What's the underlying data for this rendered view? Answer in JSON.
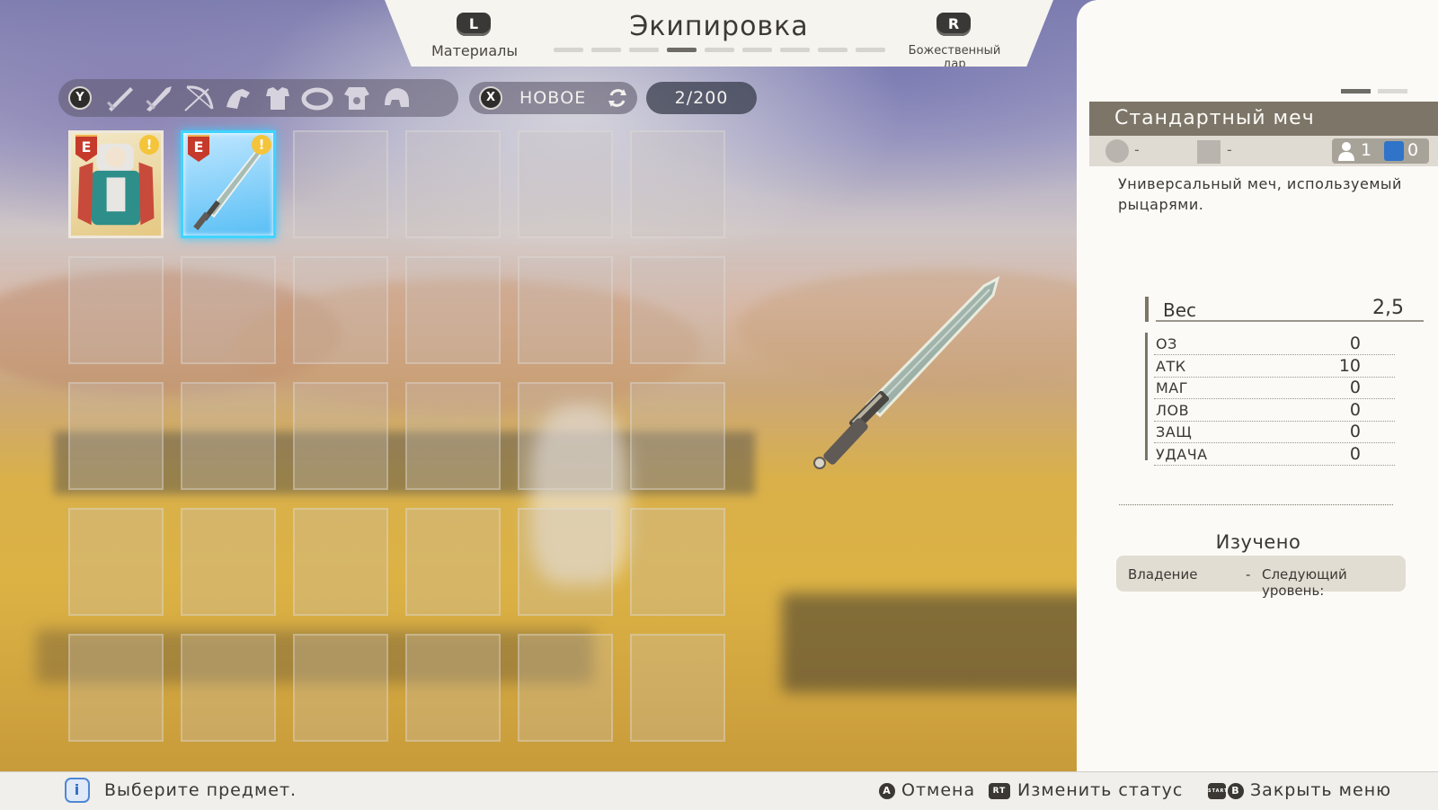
{
  "header": {
    "title": "Экипировка",
    "left_tab": {
      "button": "L",
      "label": "Материалы"
    },
    "right_tab": {
      "button": "R",
      "label": "Божественный дар"
    },
    "page_count": 9,
    "active_page": 4
  },
  "filter_bar": {
    "button": "Y",
    "categories": [
      "sword-icon",
      "greatsword-icon",
      "bow-icon",
      "gauntlet-icon",
      "armor-icon",
      "ring-icon",
      "robe-icon",
      "helmet-icon"
    ]
  },
  "sort": {
    "button": "X",
    "label": "НОВОЕ"
  },
  "inventory": {
    "count": "2/200",
    "items": [
      "knight-item",
      "sword-item"
    ],
    "selected_index": 1,
    "badge": "E",
    "warn": "!"
  },
  "detail": {
    "pages": 2,
    "active_page": 1,
    "name": "Стандартный меч",
    "element": "-",
    "type": "-",
    "owned": "1",
    "stored": "0",
    "description": "Универсальный меч, используемый рыцарями.",
    "weight": {
      "label": "Вес",
      "value": "2,5"
    },
    "stats": [
      {
        "key": "ОЗ",
        "value": "0"
      },
      {
        "key": "АТК",
        "value": "10"
      },
      {
        "key": "МАГ",
        "value": "0"
      },
      {
        "key": "ЛОВ",
        "value": "0"
      },
      {
        "key": "ЗАЩ",
        "value": "0"
      },
      {
        "key": "УДАЧА",
        "value": "0"
      }
    ],
    "learned": {
      "title": "Изучено",
      "skill": "Владение",
      "dash": "-",
      "next": "Следующий уровень:"
    }
  },
  "footer": {
    "hint": "Выберите предмет.",
    "cancel_button": "A",
    "cancel": "Отмена",
    "status_button": "RT",
    "status": "Изменить статус",
    "close_buttons": [
      "START",
      "B"
    ],
    "close": "Закрыть меню"
  },
  "colors": {
    "accent_cyan": "#40d4ff",
    "name_bar": "#7d7567",
    "badge_red": "#c63a2b",
    "warn_yellow": "#f4c43a"
  }
}
